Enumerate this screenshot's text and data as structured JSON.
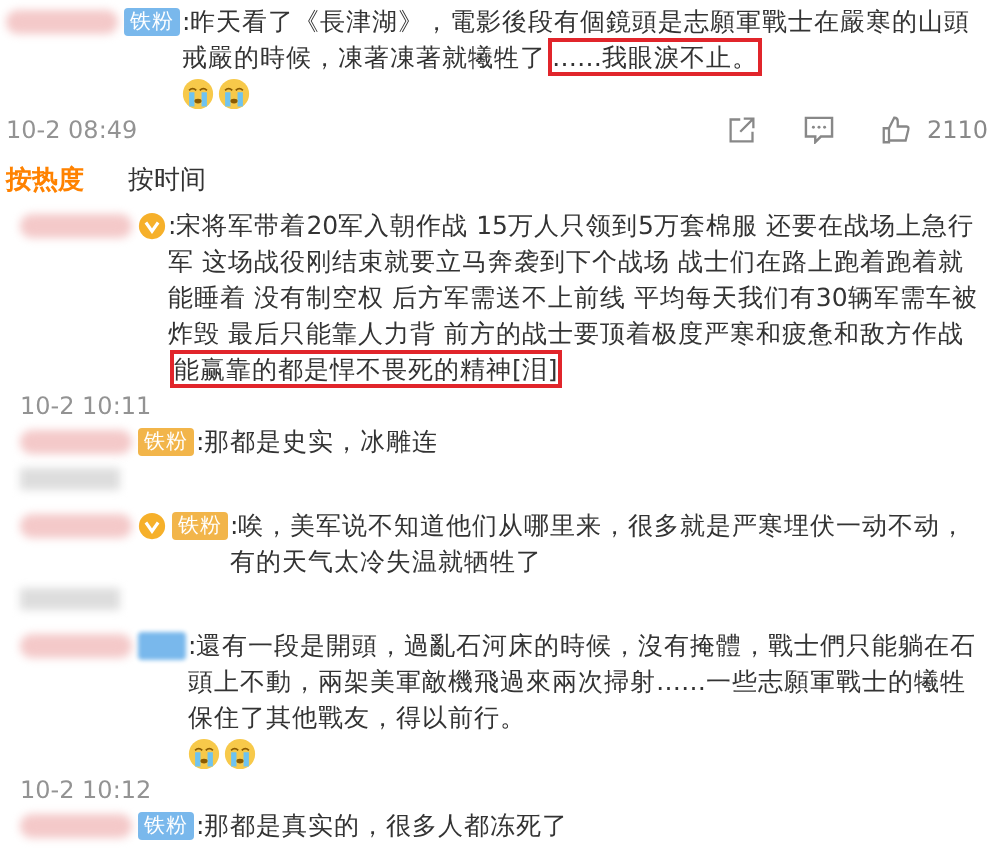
{
  "main_comment": {
    "badge": {
      "kind": "plain",
      "label": "铁粉"
    },
    "text": ":昨天看了《長津湖》，電影後段有個鏡頭是志願軍戰士在嚴寒的山頭戒嚴的時候，凍著凍著就犧牲了",
    "highlight": "……我眼淚不止。",
    "emojis": [
      {
        "kind": "crying"
      },
      {
        "kind": "crying"
      }
    ],
    "time": "10-2 08:49",
    "likes": "2110"
  },
  "sort_tabs": [
    {
      "label": "按热度",
      "selected": true
    },
    {
      "label": "按时间",
      "selected": false
    }
  ],
  "comments": [
    {
      "verified": true,
      "text": ":宋将军带着20军入朝作战 15万人只领到5万套棉服 还要在战场上急行军 这场战役刚结束就要立马奔袭到下个战场 战士们在路上跑着跑着就能睡着 没有制空权 后方军需送不上前线 平均每天我们有30辆军需车被炸毁 最后只能靠人力背 前方的战士要顶着极度严寒和疲惫和敌方作战",
      "highlight": "能赢靠的都是悍不畏死的精神[泪]",
      "time": "10-2 10:11"
    },
    {
      "verified": false,
      "badge": {
        "kind": "premium",
        "label": "铁粉"
      },
      "text": ":那都是史实，冰雕连"
    },
    {
      "verified": true,
      "badge": {
        "kind": "premium",
        "label": "铁粉"
      },
      "text": ":唉，美军说不知道他们从哪里来，很多就是严寒埋伏一动不动，有的天气太冷失温就牺牲了"
    },
    {
      "verified": false,
      "badge": {
        "kind": "plain"
      },
      "text": ":還有一段是開頭，過亂石河床的時候，沒有掩體，戰士們只能躺在石頭上不動，兩架美軍敵機飛過來兩次掃射……一些志願軍戰士的犧牲保住了其他戰友，得以前行。",
      "emojis": [
        {
          "kind": "crying"
        },
        {
          "kind": "crying"
        }
      ],
      "time": "10-2 10:12"
    },
    {
      "verified": false,
      "badge": {
        "kind": "plain",
        "label": "铁粉"
      },
      "text": ":那都是真实的，很多人都冻死了"
    }
  ]
}
